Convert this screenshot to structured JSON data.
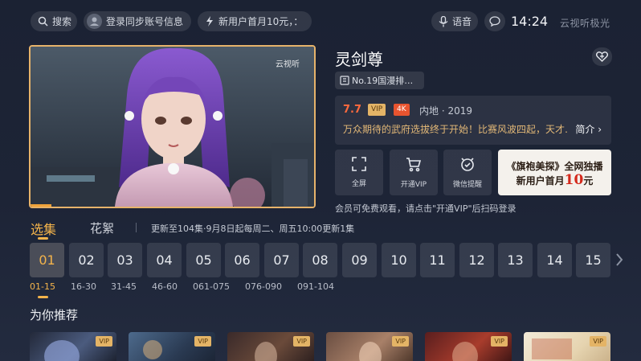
{
  "topbar": {
    "search_label": "搜索",
    "login_label": "登录同步账号信息",
    "promo_label": "新用户首月10元，：",
    "voice_label": "语音",
    "time": "14:24",
    "brand": "云视听极光"
  },
  "player": {
    "watermark": "云视听"
  },
  "show": {
    "title": "灵剑尊",
    "rank": "No.19国漫排…",
    "score": "7.7",
    "vip_badge": "VIP",
    "quality_badge": "4K",
    "meta": "内地 · 2019",
    "description": "万众期待的武府选拔终于开始！比赛风波四起，天才…",
    "more_label": "简介"
  },
  "actions": [
    {
      "label": "全屏",
      "icon": "fullscreen-icon"
    },
    {
      "label": "开通VIP",
      "icon": "cart-icon"
    },
    {
      "label": "微信提醒",
      "icon": "alarm-icon"
    }
  ],
  "promo_card": {
    "line1": "《旗袍美探》全网独播",
    "line2_prefix": "新用户首月",
    "line2_amount": "10",
    "line2_suffix": "元"
  },
  "note": "会员可免费观看，请点击\"开通VIP\"后扫码登录",
  "episodes": {
    "tab_selected": "选集",
    "tab_other": "花絮",
    "update_info": "更新至104集·9月8日起每周二、周五10:00更新1集",
    "numbers": [
      "01",
      "02",
      "03",
      "04",
      "05",
      "06",
      "07",
      "08",
      "09",
      "10",
      "11",
      "12",
      "13",
      "14",
      "15"
    ],
    "ranges": [
      "01-15",
      "16-30",
      "31-45",
      "46-60",
      "061-075",
      "076-090",
      "091-104"
    ]
  },
  "recommend": {
    "title": "为你推荐",
    "cards": [
      {
        "badge": "VIP"
      },
      {
        "badge": "VIP"
      },
      {
        "badge": "VIP"
      },
      {
        "badge": "VIP"
      },
      {
        "badge": "VIP"
      },
      {
        "badge": "VIP"
      }
    ]
  },
  "colors": {
    "accent": "#f4b44b",
    "score": "#ff6a3d",
    "vip": "#e4b466",
    "badge_4k": "#e8542f",
    "promo_red": "#d4291c"
  }
}
